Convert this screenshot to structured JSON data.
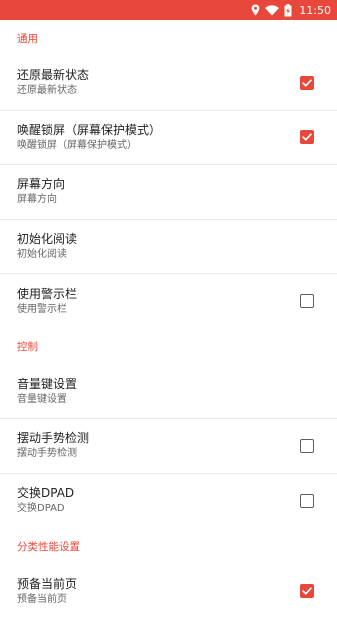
{
  "status_bar": {
    "time": "11:50",
    "background": "#e8483b",
    "icons": [
      "location-icon",
      "wifi-icon",
      "battery-icon"
    ]
  },
  "accent_color": "#e8483b",
  "sections": [
    {
      "header": "通用",
      "items": [
        {
          "title": "还原最新状态",
          "summary": "还原最新状态",
          "checkbox": true,
          "checked": true
        },
        {
          "title": "唤醒锁屏（屏幕保护模式）",
          "summary": "唤醒锁屏（屏幕保护模式）",
          "checkbox": true,
          "checked": true
        },
        {
          "title": "屏幕方向",
          "summary": "屏幕方向",
          "checkbox": false
        },
        {
          "title": "初始化阅读",
          "summary": "初始化阅读",
          "checkbox": false
        },
        {
          "title": "使用警示栏",
          "summary": "使用警示栏",
          "checkbox": true,
          "checked": false
        }
      ]
    },
    {
      "header": "控制",
      "items": [
        {
          "title": "音量键设置",
          "summary": "音量键设置",
          "checkbox": false
        },
        {
          "title": "摆动手势检测",
          "summary": "摆动手势检测",
          "checkbox": true,
          "checked": false
        },
        {
          "title": "交换DPAD",
          "summary": "交换DPAD",
          "checkbox": true,
          "checked": false
        }
      ]
    },
    {
      "header": "分类性能设置",
      "items": [
        {
          "title": "预备当前页",
          "summary": "预备当前页",
          "checkbox": true,
          "checked": true
        }
      ]
    }
  ]
}
